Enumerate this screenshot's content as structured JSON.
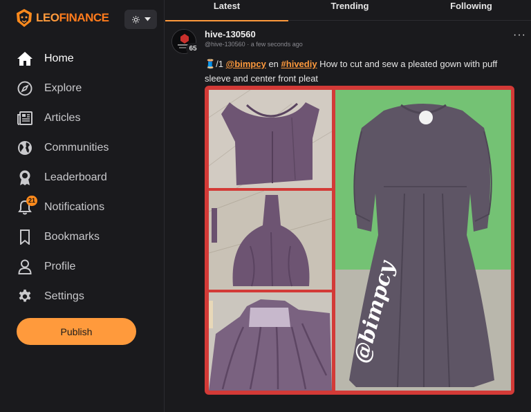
{
  "brand": {
    "leo": "LEO",
    "finance": "FINANCE"
  },
  "sidebar": {
    "items": [
      {
        "label": "Home",
        "icon": "home-icon",
        "active": true
      },
      {
        "label": "Explore",
        "icon": "compass-icon"
      },
      {
        "label": "Articles",
        "icon": "newspaper-icon"
      },
      {
        "label": "Communities",
        "icon": "globe-icon"
      },
      {
        "label": "Leaderboard",
        "icon": "award-icon"
      },
      {
        "label": "Notifications",
        "icon": "bell-icon",
        "badge": "21"
      },
      {
        "label": "Bookmarks",
        "icon": "bookmark-icon"
      },
      {
        "label": "Profile",
        "icon": "user-icon"
      },
      {
        "label": "Settings",
        "icon": "gear-icon"
      }
    ],
    "publish_label": "Publish"
  },
  "tabs": [
    {
      "label": "Latest",
      "active": true
    },
    {
      "label": "Trending"
    },
    {
      "label": "Following"
    }
  ],
  "post": {
    "author": "hive-130560",
    "handle": "@hive-130560",
    "time": "a few seconds ago",
    "reputation": "65",
    "text_prefix": "🧵/1 ",
    "mention": "@bimpcy",
    "text_en": " en ",
    "hashtag": "#hivediy",
    "text_body": " How to cut and sew a pleated gown with puff sleeve and center front pleat",
    "watermark": "@bimpcy"
  },
  "colors": {
    "accent": "#ff9a3c",
    "background": "#1a1a1d",
    "collage_border": "#d33a37",
    "badge": "#ff8a1c"
  }
}
